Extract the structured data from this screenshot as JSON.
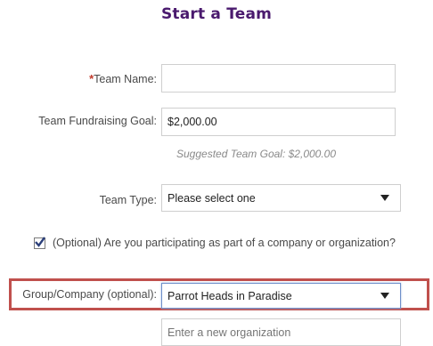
{
  "page": {
    "title": "Start a Team"
  },
  "form": {
    "team_name": {
      "label": "Team Name:",
      "required_mark": "*",
      "value": ""
    },
    "goal": {
      "label": "Team Fundraising Goal:",
      "value": "$2,000.00",
      "hint": "Suggested Team Goal: $2,000.00"
    },
    "team_type": {
      "label": "Team Type:",
      "selected": "Please select one"
    },
    "company_check": {
      "label": "(Optional) Are you participating as part of a company or organization?",
      "checked": true
    },
    "group": {
      "label": "Group/Company (optional):",
      "selected": "Parrot Heads in Paradise"
    },
    "new_org": {
      "placeholder": "Enter a new organization"
    }
  },
  "colors": {
    "title": "#4a1a6e",
    "highlight": "#c0504d",
    "required": "#c0392b"
  }
}
